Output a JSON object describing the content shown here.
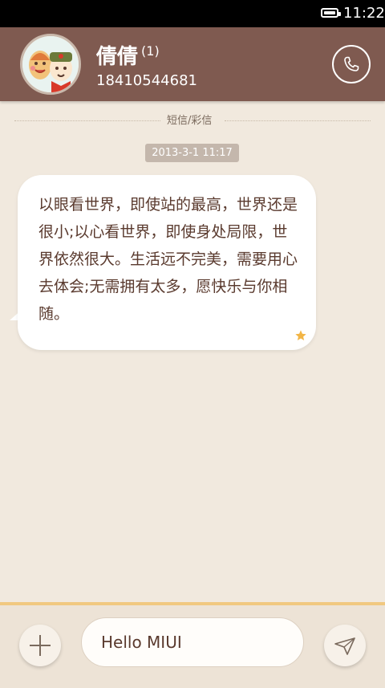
{
  "status_bar": {
    "time": "11:22",
    "battery_icon": "battery-full-icon"
  },
  "header": {
    "contact_name": "倩倩",
    "message_count": "(1)",
    "phone_number": "18410544681",
    "avatar_icon": "cartoon-couple-avatar",
    "call_icon": "phone-icon"
  },
  "conversation": {
    "divider_label": "短信/彩信",
    "timestamp": "2013-3-1 11:17",
    "messages": [
      {
        "text": "以眼看世界，即使站的最高，世界还是很小;以心看世界，即使身处局限，世界依然很大。生活远不完美，需要用心去体会;无需拥有太多，愿快乐与你相随。",
        "starred": true
      }
    ]
  },
  "composer": {
    "input_value": "Hello MIUI",
    "add_icon": "plus-icon",
    "send_icon": "paper-plane-send-icon"
  },
  "colors": {
    "header_bg": "#7f5a50",
    "page_bg": "#f1e9de",
    "accent_bar": "#f1c880",
    "star": "#f2b546"
  }
}
